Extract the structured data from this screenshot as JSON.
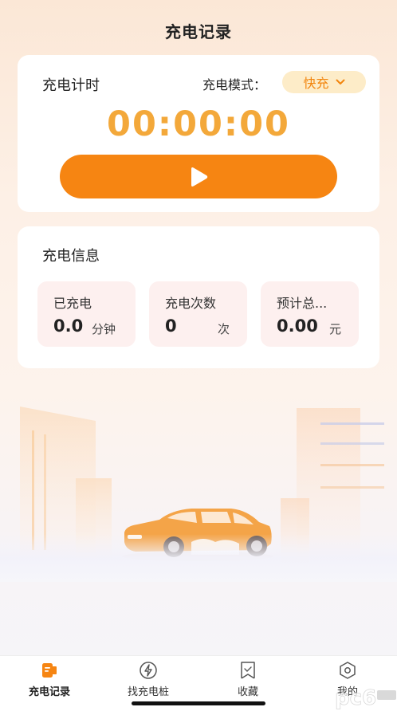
{
  "header": {
    "title": "充电记录"
  },
  "timer_card": {
    "title": "充电计时",
    "mode_label": "充电模式：",
    "mode_value": "快充",
    "timer": "00:00:00",
    "play_icon": "play-icon"
  },
  "info_card": {
    "title": "充电信息",
    "stats": [
      {
        "label": "已充电",
        "value": "0.0",
        "unit": "分钟"
      },
      {
        "label": "充电次数",
        "value": "0",
        "unit": "次"
      },
      {
        "label": "预计总...",
        "value": "0.00",
        "unit": "元"
      }
    ]
  },
  "tabbar": {
    "tabs": [
      {
        "label": "充电记录",
        "icon": "record-icon",
        "active": true
      },
      {
        "label": "找充电桩",
        "icon": "bolt-icon",
        "active": false
      },
      {
        "label": "收藏",
        "icon": "bookmark-icon",
        "active": false
      },
      {
        "label": "我的",
        "icon": "profile-icon",
        "active": false
      }
    ]
  },
  "watermark": {
    "text": "pc6"
  },
  "colors": {
    "accent": "#f68512",
    "timer": "#f3a83a",
    "mode_bg": "#fdecc8",
    "stat_bg": "#fdf0ef"
  }
}
